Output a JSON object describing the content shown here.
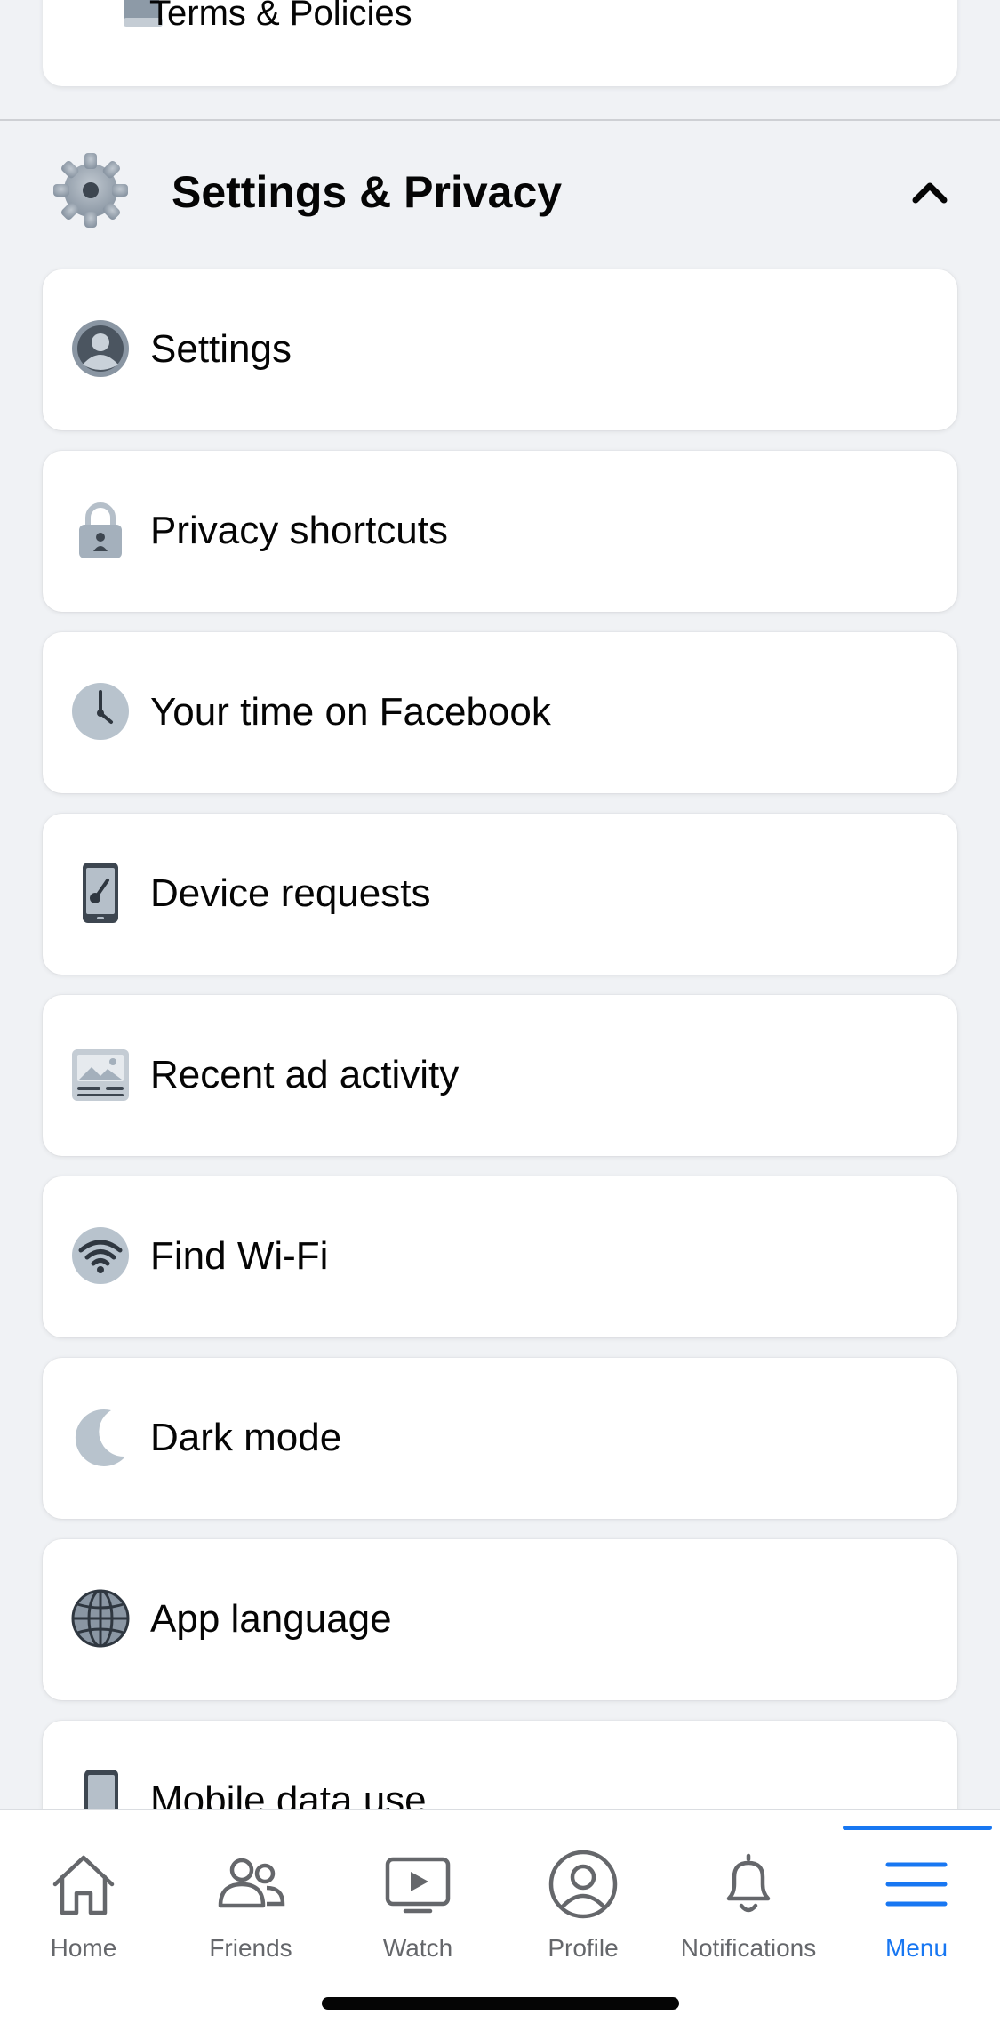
{
  "top_item": {
    "label": "Terms & Policies",
    "icon": "book-icon"
  },
  "section": {
    "title": "Settings & Privacy",
    "icon": "gear-icon",
    "toggle_icon": "chevron-up-icon"
  },
  "items": [
    {
      "label": "Settings",
      "icon": "person-icon"
    },
    {
      "label": "Privacy shortcuts",
      "icon": "lock-icon"
    },
    {
      "label": "Your time on Facebook",
      "icon": "clock-icon"
    },
    {
      "label": "Device requests",
      "icon": "phone-key-icon"
    },
    {
      "label": "Recent ad activity",
      "icon": "ad-image-icon"
    },
    {
      "label": "Find Wi-Fi",
      "icon": "wifi-icon"
    },
    {
      "label": "Dark mode",
      "icon": "moon-icon"
    },
    {
      "label": "App language",
      "icon": "globe-icon"
    },
    {
      "label": "Mobile data use",
      "icon": "phone-icon"
    }
  ],
  "bottom_nav": [
    {
      "label": "Home",
      "icon": "home-icon",
      "active": false
    },
    {
      "label": "Friends",
      "icon": "friends-icon",
      "active": false
    },
    {
      "label": "Watch",
      "icon": "watch-icon",
      "active": false
    },
    {
      "label": "Profile",
      "icon": "profile-icon",
      "active": false
    },
    {
      "label": "Notifications",
      "icon": "bell-icon",
      "active": false
    },
    {
      "label": "Menu",
      "icon": "menu-icon",
      "active": true
    }
  ],
  "colors": {
    "accent": "#1877f2",
    "background": "#f0f2f5",
    "icon_gray": "#8a96a3"
  }
}
